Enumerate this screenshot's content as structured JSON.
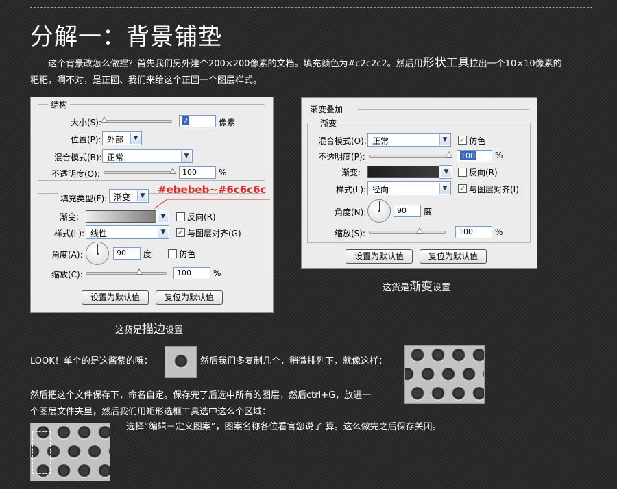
{
  "title": "分解一：背景铺垫",
  "intro": {
    "part1": "这个背景改怎么做捏？首先我们另外建个200×200像素的文档。填充颜色为#c2c2c2。然后用",
    "tool": "形状工具",
    "part2": "拉出一个10×10像素的",
    "line2": "粑粑，啊不对，是正圆、我们来给这个正圆一个图层样式。"
  },
  "stroke_dialog": {
    "group_structure": "结构",
    "size_label": "大小(S):",
    "size_value": "2",
    "size_unit": "像素",
    "position_label": "位置(P):",
    "position_value": "外部",
    "blend_label": "混合模式(B):",
    "blend_value": "正常",
    "opacity_label": "不透明度(O):",
    "opacity_value": "100",
    "opacity_pct": 100,
    "opacity_unit": "%",
    "fill_type_label": "填充类型(F):",
    "fill_type_value": "渐变",
    "gradient_label": "渐变:",
    "reverse_label": "反向(R)",
    "style_label": "样式(L):",
    "style_value": "线性",
    "align_label": "与图层对齐(G)",
    "angle_label": "角度(A):",
    "angle_value": "90",
    "angle_unit": "度",
    "dither_label": "仿色",
    "scale_label": "缩放(C):",
    "scale_value": "100",
    "scale_pct": 100,
    "scale_unit": "%",
    "btn_default": "设置为默认值",
    "btn_reset": "复位为默认值",
    "caption_pre": "这货是",
    "caption_big": "描边",
    "caption_post": "设置"
  },
  "annotation": "#ebebeb~#6c6c6c",
  "gradient_dialog": {
    "outer_title": "渐变叠加",
    "group_title": "渐变",
    "blend_label": "混合模式(O):",
    "blend_value": "正常",
    "dither_label": "仿色",
    "opacity_label": "不透明度(P):",
    "opacity_value": "100",
    "opacity_pct": 100,
    "opacity_unit": "%",
    "gradient_label": "渐变:",
    "reverse_label": "反向(R)",
    "style_label": "样式(L):",
    "style_value": "径向",
    "align_label": "与图层对齐(I)",
    "angle_label": "角度(N):",
    "angle_value": "90",
    "angle_unit": "度",
    "scale_label": "缩放(S):",
    "scale_value": "100",
    "scale_pct": 100,
    "scale_unit": "%",
    "btn_default": "设置为默认值",
    "btn_reset": "复位为默认值",
    "caption_pre": "这货是",
    "caption_big": "渐变",
    "caption_post": "设置"
  },
  "look_line": {
    "text1": "LOOK！单个的是这酱紫的哦：",
    "text2": "然后我们多复制几个，稍微排列下，就像这样："
  },
  "save_para": {
    "line1": "然后把这个文件保存下，命名自定。保存完了后选中所有的图层，然后ctrl+G，放进一",
    "line2": "个图层文件夹里，然后我们用矩形选框工具选中这么个区域："
  },
  "define_line": "选择“编辑－定义图案”，图案名称各位看官您说了 算。这么做完之后保存关闭。",
  "colors": {
    "background": "#2b2b2b",
    "tile_fill": "#c2c2c2",
    "annotation": "#e82828",
    "gradient_light": "#ebebeb",
    "gradient_dark": "#6c6c6c"
  }
}
